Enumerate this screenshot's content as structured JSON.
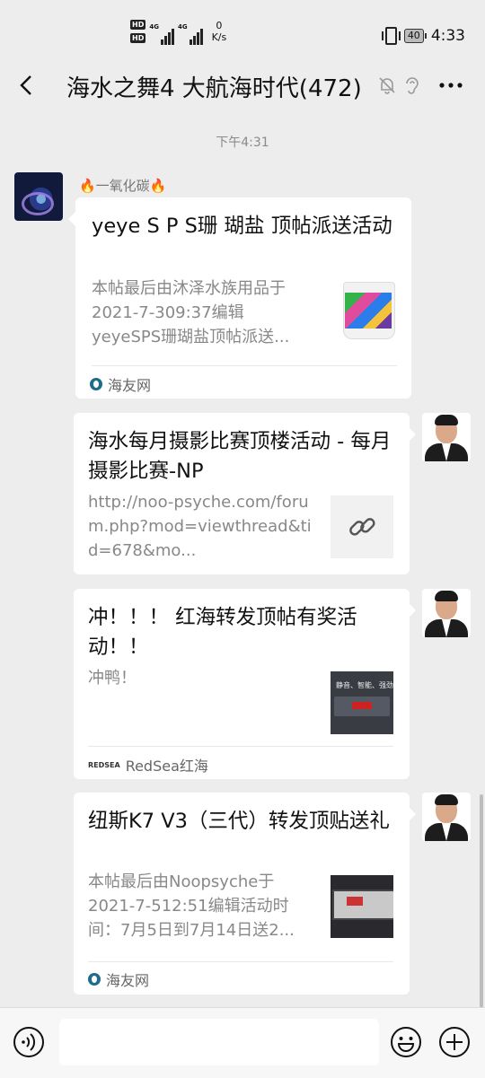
{
  "status_bar": {
    "hd1": "HD",
    "hd2": "HD",
    "net1": "4G",
    "net2": "4G",
    "speed_value": "0",
    "speed_unit": "K/s",
    "battery": "40",
    "time": "4:33"
  },
  "header": {
    "title": "海水之舞4 大航海时代(472)",
    "icons": [
      "back-icon",
      "mute-bell-icon",
      "ear-icon",
      "more-icon"
    ]
  },
  "chat": {
    "timestamp": "下午4:31",
    "messages": [
      {
        "sender": "🔥一氧化碳🔥",
        "side": "left",
        "title": "yeye S P S珊 瑚盐 顶帖派送活动",
        "description": "本帖最后由沐泽水族用品于2021-7-309:37编辑yeyeSPS珊瑚盐顶帖派送...",
        "source": "海友网",
        "thumbnail": "salt-bucket-thumbnail"
      },
      {
        "side": "right",
        "title": "海水每月摄影比赛顶楼活动 - 每月摄影比赛-NP",
        "description": "http://noo-psyche.com/forum.php?mod=viewthread&tid=678&mo...",
        "thumbnail": "link-icon"
      },
      {
        "side": "right",
        "title": "冲！！！ 红海转发顶帖有奖活动！！",
        "description": "冲鸭！",
        "source": "RedSea红海",
        "source_logo": "REDSEA",
        "thumbnail": "product-banner-thumbnail",
        "thumb_text": "静音、智能、强劲"
      },
      {
        "side": "right",
        "title": "纽斯K7 V3（三代）转发顶贴送礼",
        "description": "本帖最后由Noopsyche于2021-7-512:51编辑活动时间：7月5日到7月14日送2...",
        "source": "海友网",
        "thumbnail": "k7-device-thumbnail"
      }
    ]
  },
  "input_bar": {
    "placeholder": "",
    "icons": [
      "voice-icon",
      "emoji-icon",
      "plus-icon"
    ]
  },
  "colors": {
    "background": "#ededed",
    "card": "#ffffff",
    "muted_text": "#888888"
  }
}
